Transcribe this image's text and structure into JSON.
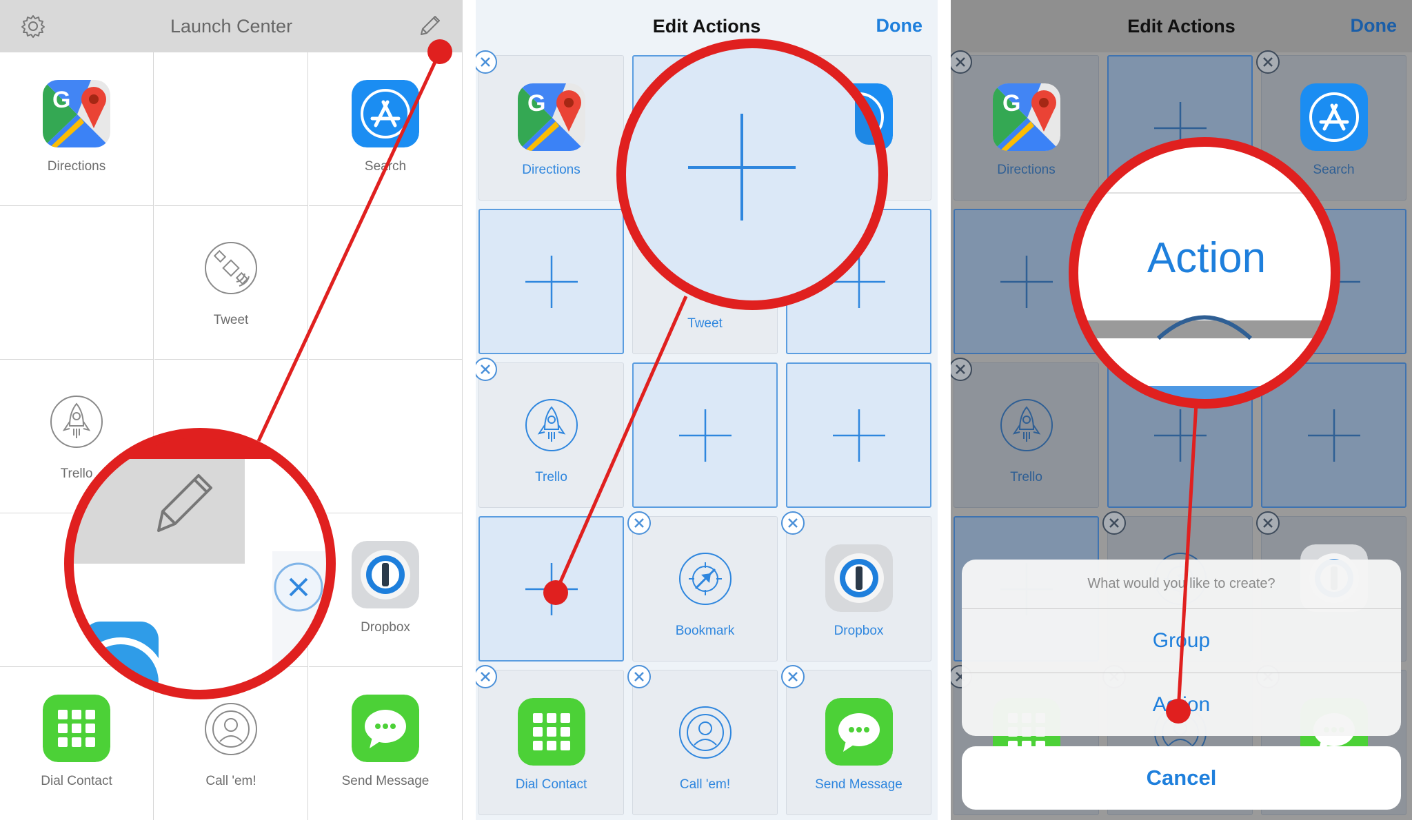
{
  "panel1": {
    "title": "Launch Center",
    "icons": {
      "settings": "gear-icon",
      "edit": "pencil-icon"
    },
    "cells": [
      {
        "label": "Directions",
        "icon": "google-maps-icon"
      },
      {
        "label": "",
        "icon": ""
      },
      {
        "label": "Search",
        "icon": "app-store-icon"
      },
      {
        "label": "",
        "icon": ""
      },
      {
        "label": "Tweet",
        "icon": "satellite-icon"
      },
      {
        "label": "",
        "icon": ""
      },
      {
        "label": "Trello",
        "icon": "rocket-icon"
      },
      {
        "label": "",
        "icon": ""
      },
      {
        "label": "",
        "icon": ""
      },
      {
        "label": "",
        "icon": ""
      },
      {
        "label": "",
        "icon": ""
      },
      {
        "label": "Dropbox",
        "icon": "1password-icon"
      },
      {
        "label": "Dial Contact",
        "icon": "keypad-icon"
      },
      {
        "label": "Call 'em!",
        "icon": "contact-icon"
      },
      {
        "label": "Send Message",
        "icon": "messages-icon"
      }
    ]
  },
  "panel2": {
    "title": "Edit Actions",
    "done_label": "Done",
    "cells": [
      {
        "label": "Directions",
        "icon": "google-maps-icon",
        "empty": false
      },
      {
        "label": "",
        "icon": "plus-icon",
        "empty": true
      },
      {
        "label": "Search",
        "icon": "app-store-icon",
        "empty": false
      },
      {
        "label": "",
        "icon": "plus-icon",
        "empty": true
      },
      {
        "label": "Tweet",
        "icon": "satellite-icon",
        "empty": false
      },
      {
        "label": "",
        "icon": "plus-icon",
        "empty": true
      },
      {
        "label": "Trello",
        "icon": "rocket-icon",
        "empty": false
      },
      {
        "label": "",
        "icon": "plus-icon",
        "empty": true
      },
      {
        "label": "",
        "icon": "plus-icon",
        "empty": true
      },
      {
        "label": "",
        "icon": "plus-icon",
        "empty": true
      },
      {
        "label": "Bookmark",
        "icon": "compass-icon",
        "empty": false
      },
      {
        "label": "Dropbox",
        "icon": "1password-icon",
        "empty": false
      },
      {
        "label": "Dial Contact",
        "icon": "keypad-icon",
        "empty": false
      },
      {
        "label": "Call 'em!",
        "icon": "contact-icon",
        "empty": false
      },
      {
        "label": "Send Message",
        "icon": "messages-icon",
        "empty": false
      }
    ]
  },
  "panel3": {
    "title": "Edit Actions",
    "done_label": "Done",
    "visible_labels": [
      "Directions",
      "Search",
      "Trello"
    ],
    "sheet": {
      "prompt": "What would you like to create?",
      "options": [
        "Group",
        "Action"
      ],
      "cancel_label": "Cancel"
    },
    "magnifier_text": "Action"
  },
  "colors": {
    "ios_blue": "#1e7fdc",
    "callout_red": "#e0201f",
    "grid_line": "#d6d6d6"
  }
}
